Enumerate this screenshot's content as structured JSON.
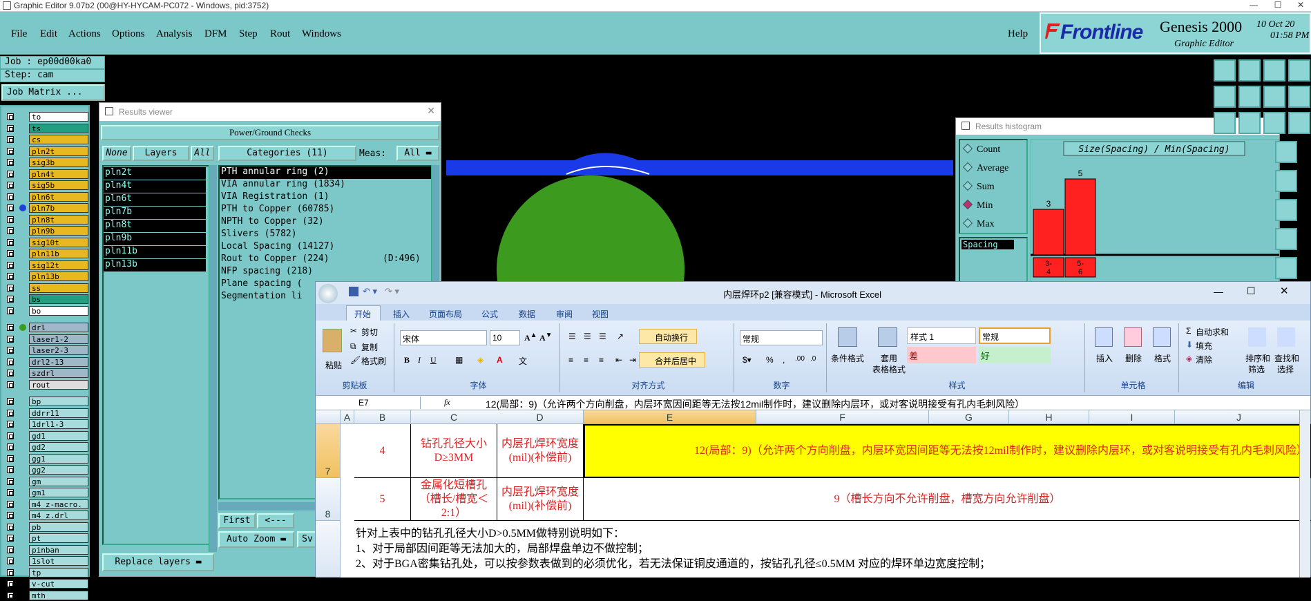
{
  "window": {
    "title": "Graphic Editor 9.07b2 (00@HY-HYCAM-PC072 - Windows, pid:3752)"
  },
  "menu": [
    "File",
    "Edit",
    "Actions",
    "Options",
    "Analysis",
    "DFM",
    "Step",
    "Rout",
    "Windows"
  ],
  "help": "Help",
  "brand": {
    "logo": "Frontline",
    "product": "Genesis 2000",
    "subtitle": "Graphic Editor",
    "date": "10 Oct 20",
    "time": "01:58 PM"
  },
  "job": {
    "job": "Job : ep00d00ka0",
    "step": "Step: cam",
    "matrix": "Job Matrix ..."
  },
  "layers": [
    "to",
    "ts",
    "cs",
    "pln2t",
    "sig3b",
    "pln4t",
    "sig5b",
    "pln6t",
    "pln7b",
    "pln8t",
    "pln9b",
    "sig10t",
    "pln11b",
    "sig12t",
    "pln13b",
    "ss",
    "bs",
    "bo"
  ],
  "layers2": [
    "drl",
    "laser1-2",
    "laser2-3",
    "drl2-13",
    "szdrl",
    "rout"
  ],
  "layers3": [
    "bp",
    "ddrr11",
    "1drl1-3",
    "gd1",
    "gd2",
    "gg1",
    "gg2",
    "gm",
    "gm1",
    "m4_z-macro.",
    "m4_z.drl",
    "pb",
    "pt",
    "pinban",
    "1slot",
    "tp",
    "v-cut",
    "mth"
  ],
  "colors": {
    "teal": "#7cc8c8",
    "yellow_layer": "#e8b820",
    "green_layer": "#20a080",
    "excel_yellow": "#ffff00"
  },
  "results_viewer": {
    "title": "Results viewer",
    "header": "Power/Ground Checks",
    "none_btn": "None",
    "layers_lbl": "Layers",
    "all_btn": "All",
    "categories": "Categories (11)",
    "meas": "Meas:",
    "meas_val": "All",
    "layer_items": [
      "pln2t",
      "pln4t",
      "pln6t",
      "pln7b",
      "pln8t",
      "pln9b",
      "pln11b",
      "pln13b"
    ],
    "cat_items": [
      "PTH annular ring (2)",
      "VIA annular ring (1834)",
      "VIA Registration (1)",
      "PTH to Copper (60785)",
      "NPTH to Copper (32)",
      "Slivers (5782)",
      "Local Spacing (14127)",
      "Rout to Copper (224)",
      "NFP spacing (218)",
      "Plane spacing (",
      "Segmentation li"
    ],
    "cat_extra": "(D:496)",
    "first": "First",
    "prev": "<---",
    "auto_zoom": "Auto Zoom",
    "sv": "Sv",
    "replace": "Replace layers"
  },
  "histogram": {
    "title": "Results histogram",
    "options": [
      "Count",
      "Average",
      "Sum",
      "Min",
      "Max"
    ],
    "selected": "Min",
    "spacing": "Spacing",
    "chart_title": "Size(Spacing) / Min(Spacing)",
    "bars": [
      {
        "label": "3-\n4",
        "value": 3
      },
      {
        "label": "5-\n6",
        "value": 5
      }
    ]
  },
  "excel": {
    "title": "内层焊环p2  [兼容模式] - Microsoft Excel",
    "tabs": [
      "开始",
      "插入",
      "页面布局",
      "公式",
      "数据",
      "审阅",
      "视图"
    ],
    "clipboard": {
      "paste": "粘贴",
      "cut": "剪切",
      "copy": "复制",
      "format": "格式刷",
      "label": "剪贴板"
    },
    "font": {
      "name": "宋体",
      "size": "10",
      "label": "字体"
    },
    "align": {
      "wrap": "自动换行",
      "merge": "合并后居中",
      "label": "对齐方式"
    },
    "number": {
      "format": "常规",
      "label": "数字"
    },
    "styles": {
      "cond": "条件格式",
      "table": "套用",
      "table2": "表格格式",
      "style1": "样式 1",
      "normal": "常规",
      "bad": "差",
      "good": "好",
      "label": "样式"
    },
    "cells": {
      "insert": "插入",
      "delete": "删除",
      "format": "格式",
      "label": "单元格"
    },
    "edit": {
      "autosum": "自动求和",
      "fill": "填充",
      "clear": "清除",
      "sort": "排序和",
      "sort2": "筛选",
      "find": "查找和",
      "find2": "选择",
      "label": "编辑"
    },
    "namebox": "E7",
    "formula": "12(局部：9)（允许两个方向削盘，内层环宽因间距等无法按12mil制作时，建议删除内层环，或对客说明接受有孔内毛刺风险）",
    "cols": [
      "A",
      "B",
      "C",
      "D",
      "E",
      "F",
      "G",
      "H",
      "I",
      "J"
    ],
    "row7": {
      "num": "7",
      "b": "4",
      "c": "钻孔孔径大小D≥3MM",
      "d": "内层孔焊环宽度(mil)(补偿前)",
      "e": "12(局部：9)（允许两个方向削盘，内层环宽因间距等无法按12mil制作时，建议删除内层环，或对客说明接受有孔内毛刺风险）"
    },
    "row8": {
      "num": "8",
      "b": "5",
      "c": "金属化短槽孔（槽长/槽宽＜2:1）",
      "d": "内层孔焊环宽度(mil)(补偿前)",
      "e": "9（槽长方向不允许削盘，槽宽方向允许削盘）"
    },
    "note1": "针对上表中的钻孔孔径大小D>0.5MM做特别说明如下：",
    "note2": "1、对于局部因间距等无法加大的，局部焊盘单边不做控制；",
    "note3": "2、对于BGA密集钻孔处，可以按参数表做到的必须优化，若无法保证铜皮通道的，按钻孔孔径≤0.5MM 对应的焊环单边宽度控制；"
  }
}
